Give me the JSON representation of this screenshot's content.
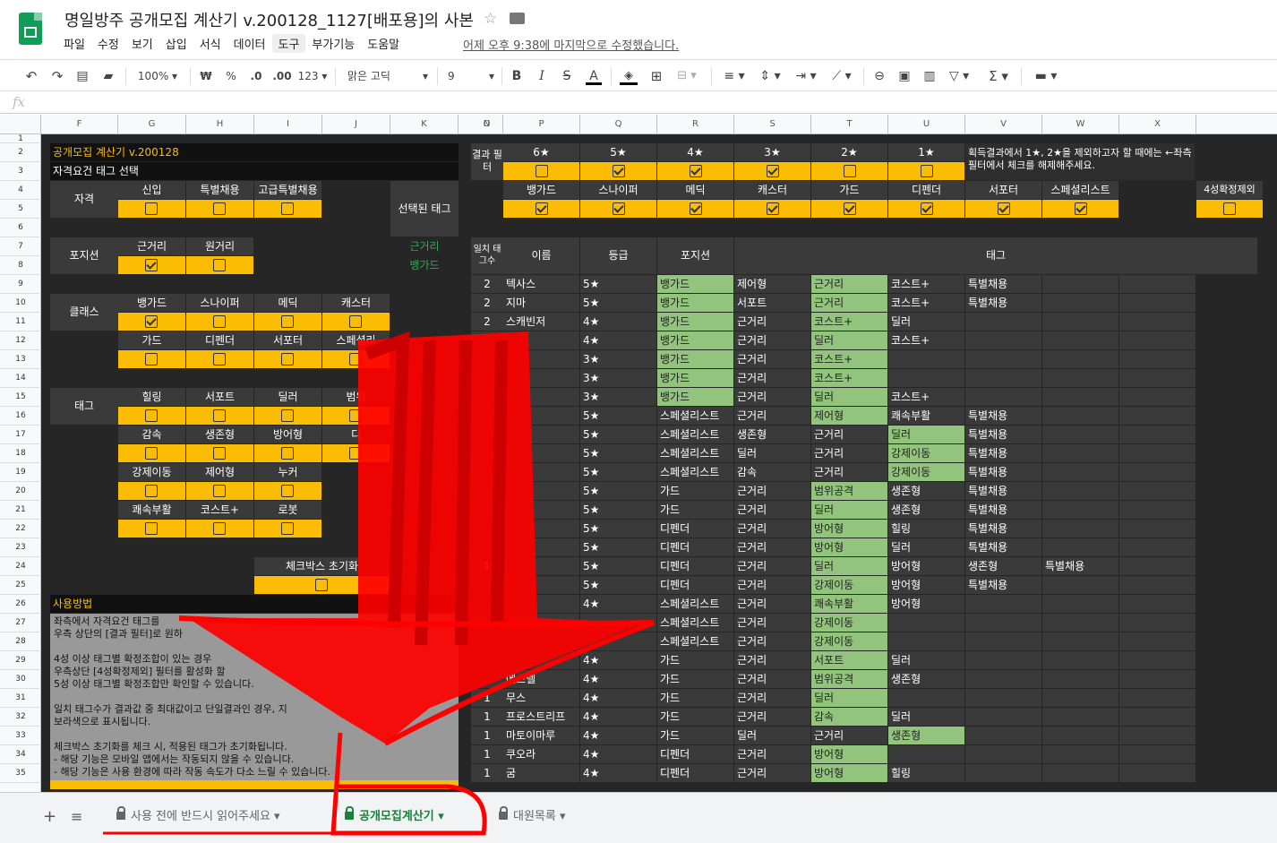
{
  "app": {
    "title": "명일방주 공개모집 계산기 v.200128_1127[배포용]의 사본",
    "menus": [
      "파일",
      "수정",
      "보기",
      "삽입",
      "서식",
      "데이터",
      "도구",
      "부가기능",
      "도움말"
    ],
    "last_edit": "어제 오후 9:38에 마지막으로 수정했습니다."
  },
  "toolbar": {
    "zoom": "100%",
    "currency": "₩",
    "percent": "%",
    "dec_less": ".0",
    "dec_more": ".00",
    "format": "123",
    "font": "맑은 고딕",
    "size": "9",
    "fx": "fx"
  },
  "columns": [
    "F",
    "G",
    "H",
    "I",
    "J",
    "K",
    "N",
    "O",
    "P",
    "Q",
    "R",
    "S",
    "T",
    "U",
    "V",
    "W",
    "X"
  ],
  "rows": [
    "1",
    "2",
    "3",
    "4",
    "5",
    "6",
    "7",
    "8",
    "9",
    "10",
    "11",
    "12",
    "13",
    "14",
    "15",
    "16",
    "17",
    "18",
    "19",
    "20",
    "21",
    "22",
    "23",
    "24",
    "25",
    "26",
    "27",
    "28",
    "29",
    "30",
    "31",
    "32",
    "33",
    "34",
    "35"
  ],
  "left": {
    "title": "공개모집 계산기 v.200128",
    "subtitle": "자격요건 태그 선택",
    "qual_label": "자격",
    "qual": [
      "신입",
      "특별채용",
      "고급특별채용"
    ],
    "selected_label": "선택된 태그",
    "selected": [
      "근거리",
      "뱅가드"
    ],
    "pos_label": "포지션",
    "pos": [
      "근거리",
      "원거리"
    ],
    "class_label": "클래스",
    "class1": [
      "뱅가드",
      "스나이퍼",
      "메딕",
      "캐스터"
    ],
    "class2": [
      "가드",
      "디펜더",
      "서포터",
      "스페셜리"
    ],
    "tag_label": "태그",
    "tag1": [
      "힐링",
      "서포트",
      "딜러",
      "범위"
    ],
    "tag2": [
      "감속",
      "생존형",
      "방어형",
      "디"
    ],
    "tag3": [
      "강제이동",
      "제어형",
      "누커",
      ""
    ],
    "tag4": [
      "쾌속부활",
      "코스트+",
      "로봇",
      ""
    ],
    "reset": "체크박스 초기화",
    "usage_title": "사용방법",
    "usage_lines": [
      "좌측에서 자격요건 태그를",
      "우측 상단의 [결과 필터]로 원하",
      "",
      "4성 이상 태그별 확정조합이 있는 경우",
      "우측상단 [4성확정제외] 필터를 활성화 할",
      "5성 이상 태그별 확정조합만 확인할 수 있습니다.",
      "",
      "일치 태그수가 결과값 중 최대값이고 단일결과인 경우, 지",
      "보라색으로 표시됩니다.",
      "",
      "체크박스 초기화를 체크 시, 적용된 태그가 초기화됩니다.",
      "- 해당 기능은 모바일 앱에서는 작동되지 않을 수 있습니다.",
      "- 해당 기능은 사용 환경에 따라 작동 속도가 다소 느릴 수 있습니다."
    ]
  },
  "right": {
    "filter_label": "결과 필터",
    "stars": [
      "6★",
      "5★",
      "4★",
      "3★",
      "2★",
      "1★"
    ],
    "star_checked": [
      false,
      true,
      true,
      true,
      false,
      false
    ],
    "note": "획득결과에서 1★, 2★을 제외하고자 할 때에는 ←좌측 필터에서 체크를 해제해주세요.",
    "classes": [
      "뱅가드",
      "스나이퍼",
      "메딕",
      "캐스터",
      "가드",
      "디펜더",
      "서포터",
      "스페셜리스트"
    ],
    "exclude4": "4성확정제외",
    "headers": {
      "match": "일치 태그수",
      "name": "이름",
      "grade": "등급",
      "position": "포지션",
      "tags": "태그"
    },
    "results": [
      {
        "n": "2",
        "name": "텍사스",
        "g": "5★",
        "p": "뱅가드",
        "t": [
          "제어형",
          "근거리",
          "코스트+",
          "특별채용"
        ],
        "green": [
          0,
          2
        ]
      },
      {
        "n": "2",
        "name": "지마",
        "g": "5★",
        "p": "뱅가드",
        "t": [
          "서포트",
          "근거리",
          "코스트+",
          "특별채용"
        ],
        "green": [
          0,
          2
        ]
      },
      {
        "n": "2",
        "name": "스캐빈저",
        "g": "4★",
        "p": "뱅가드",
        "t": [
          "근거리",
          "코스트+",
          "딜러",
          ""
        ],
        "green": [
          0,
          1
        ]
      },
      {
        "n": "",
        "name": "",
        "g": "4★",
        "p": "뱅가드",
        "t": [
          "근거리",
          "딜러",
          "코스트+",
          ""
        ],
        "green": [
          0,
          1
        ]
      },
      {
        "n": "",
        "name": "",
        "g": "3★",
        "p": "뱅가드",
        "t": [
          "근거리",
          "코스트+",
          "",
          ""
        ],
        "green": [
          0,
          1
        ]
      },
      {
        "n": "",
        "name": "",
        "g": "3★",
        "p": "뱅가드",
        "t": [
          "근거리",
          "코스트+",
          "",
          ""
        ],
        "green": [
          0,
          1
        ]
      },
      {
        "n": "",
        "name": "",
        "g": "3★",
        "p": "뱅가드",
        "t": [
          "근거리",
          "딜러",
          "코스트+",
          ""
        ],
        "green": [
          0,
          1
        ]
      },
      {
        "n": "",
        "name": "",
        "g": "5★",
        "p": "스페셜리스트",
        "t": [
          "근거리",
          "제어형",
          "쾌속부활",
          "특별채용"
        ],
        "green": [
          1
        ]
      },
      {
        "n": "",
        "name": "",
        "g": "5★",
        "p": "스페셜리스트",
        "t": [
          "생존형",
          "근거리",
          "딜러",
          "특별채용"
        ],
        "green": [
          2
        ]
      },
      {
        "n": "",
        "name": "",
        "g": "5★",
        "p": "스페셜리스트",
        "t": [
          "딜러",
          "근거리",
          "강제이동",
          "특별채용"
        ],
        "green": [
          2
        ]
      },
      {
        "n": "",
        "name": "",
        "g": "5★",
        "p": "스페셜리스트",
        "t": [
          "감속",
          "근거리",
          "강제이동",
          "특별채용"
        ],
        "green": [
          2
        ]
      },
      {
        "n": "",
        "name": "",
        "g": "5★",
        "p": "가드",
        "t": [
          "근거리",
          "범위공격",
          "생존형",
          "특별채용"
        ],
        "green": [
          1
        ]
      },
      {
        "n": "",
        "name": "",
        "g": "5★",
        "p": "가드",
        "t": [
          "근거리",
          "딜러",
          "생존형",
          "특별채용"
        ],
        "green": [
          1
        ]
      },
      {
        "n": "",
        "name": "",
        "g": "5★",
        "p": "디펜더",
        "t": [
          "근거리",
          "방어형",
          "힐링",
          "특별채용"
        ],
        "green": [
          1
        ]
      },
      {
        "n": "",
        "name": "",
        "g": "5★",
        "p": "디펜더",
        "t": [
          "근거리",
          "방어형",
          "딜러",
          "특별채용"
        ],
        "green": [
          1
        ]
      },
      {
        "n": "1",
        "name": "",
        "g": "5★",
        "p": "디펜더",
        "t": [
          "근거리",
          "딜러",
          "방어형",
          "생존형",
          "특별채용"
        ],
        "green": [
          1
        ]
      },
      {
        "n": "",
        "name": "",
        "g": "5★",
        "p": "디펜더",
        "t": [
          "근거리",
          "강제이동",
          "방어형",
          "특별채용"
        ],
        "green": [
          1
        ]
      },
      {
        "n": "",
        "name": "",
        "g": "4★",
        "p": "스페셜리스트",
        "t": [
          "근거리",
          "쾌속부활",
          "방어형",
          ""
        ],
        "green": [
          1
        ]
      },
      {
        "n": "",
        "name": "",
        "g": "",
        "p": "스페셜리스트",
        "t": [
          "근거리",
          "강제이동",
          "",
          ""
        ],
        "green": [
          1
        ]
      },
      {
        "n": "",
        "name": "",
        "g": "",
        "p": "스페셜리스트",
        "t": [
          "근거리",
          "강제이동",
          "",
          ""
        ],
        "green": [
          1
        ]
      },
      {
        "n": "",
        "name": "",
        "g": "4★",
        "p": "가드",
        "t": [
          "근거리",
          "서포트",
          "딜러",
          ""
        ],
        "green": [
          1
        ]
      },
      {
        "n": "",
        "name": "에스텔",
        "g": "4★",
        "p": "가드",
        "t": [
          "근거리",
          "범위공격",
          "생존형",
          ""
        ],
        "green": [
          1
        ]
      },
      {
        "n": "1",
        "name": "무스",
        "g": "4★",
        "p": "가드",
        "t": [
          "근거리",
          "딜러",
          "",
          ""
        ],
        "green": [
          1
        ]
      },
      {
        "n": "1",
        "name": "프로스트리프",
        "g": "4★",
        "p": "가드",
        "t": [
          "근거리",
          "감속",
          "딜러",
          ""
        ],
        "green": [
          1
        ]
      },
      {
        "n": "1",
        "name": "마토이마루",
        "g": "4★",
        "p": "가드",
        "t": [
          "딜러",
          "근거리",
          "생존형",
          ""
        ],
        "green": [
          2
        ]
      },
      {
        "n": "1",
        "name": "쿠오라",
        "g": "4★",
        "p": "디펜더",
        "t": [
          "근거리",
          "방어형",
          "",
          ""
        ],
        "green": [
          1
        ]
      },
      {
        "n": "1",
        "name": "굼",
        "g": "4★",
        "p": "디펜더",
        "t": [
          "근거리",
          "방어형",
          "힐링",
          ""
        ],
        "green": [
          1
        ]
      }
    ]
  },
  "tabs": [
    "사용 전에 반드시 읽어주세요",
    "공개모집계산기",
    "대원목록"
  ]
}
